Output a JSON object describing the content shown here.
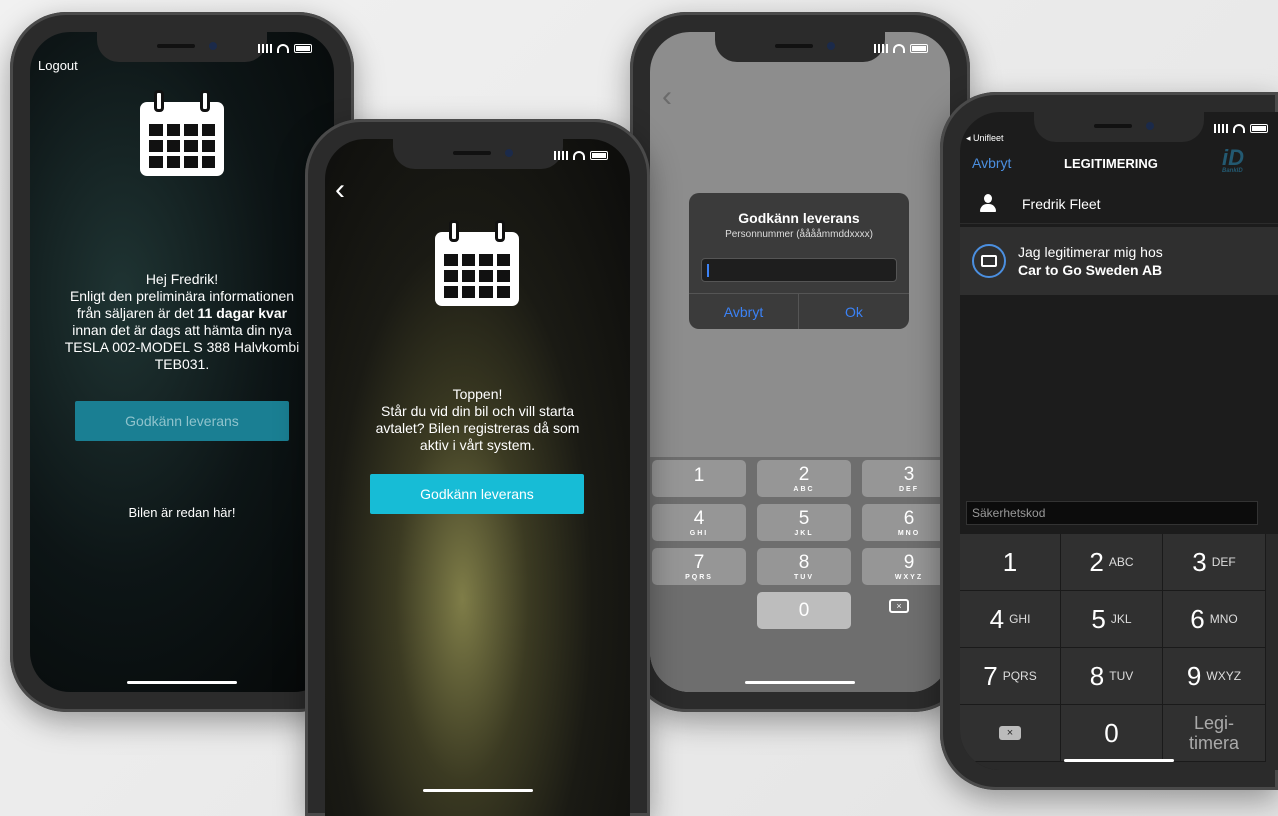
{
  "phone1": {
    "logout": "Logout",
    "message_line1": "Hej Fredrik!",
    "message_line2": "Enligt den preliminära informationen",
    "message_line3": "från säljaren är det",
    "message_bold": "11 dagar kvar",
    "message_line4": "innan det är dags att hämta din nya",
    "message_line5": "TESLA 002-MODEL S 388 Halvkombi",
    "message_line6": "TEB031.",
    "approve_button": "Godkänn leverans",
    "car_here": "Bilen är redan här!"
  },
  "phone2": {
    "back": "‹",
    "title": "Toppen!",
    "line1": "Står du vid din bil och vill starta",
    "line2": "avtalet? Bilen registreras då som",
    "line3": "aktiv i vårt system.",
    "approve_button": "Godkänn leverans"
  },
  "phone3": {
    "back": "‹",
    "dialog_title": "Godkänn leverans",
    "dialog_subtitle": "Personnummer (ååååmmddxxxx)",
    "cancel": "Avbryt",
    "ok": "Ok",
    "keys": [
      {
        "n": "1",
        "l": ""
      },
      {
        "n": "2",
        "l": "ABC"
      },
      {
        "n": "3",
        "l": "DEF"
      },
      {
        "n": "4",
        "l": "GHI"
      },
      {
        "n": "5",
        "l": "JKL"
      },
      {
        "n": "6",
        "l": "MNO"
      },
      {
        "n": "7",
        "l": "PQRS"
      },
      {
        "n": "8",
        "l": "TUV"
      },
      {
        "n": "9",
        "l": "WXYZ"
      },
      {
        "n": "0",
        "l": ""
      }
    ]
  },
  "phone4": {
    "back_app": "◂ Unifleet",
    "cancel": "Avbryt",
    "title": "LEGITIMERING",
    "bankid": "BankID",
    "user_name": "Fredrik Fleet",
    "identify_line1": "Jag legitimerar mig hos",
    "identify_line2": "Car to Go Sweden AB",
    "security_placeholder": "Säkerhetskod",
    "keys": [
      {
        "n": "1",
        "l": ""
      },
      {
        "n": "2",
        "l": "ABC"
      },
      {
        "n": "3",
        "l": "DEF"
      },
      {
        "n": "4",
        "l": "GHI"
      },
      {
        "n": "5",
        "l": "JKL"
      },
      {
        "n": "6",
        "l": "MNO"
      },
      {
        "n": "7",
        "l": "PQRS"
      },
      {
        "n": "8",
        "l": "TUV"
      },
      {
        "n": "9",
        "l": "WXYZ"
      },
      {
        "n": "0",
        "l": ""
      }
    ],
    "legitimera_line1": "Legi-",
    "legitimera_line2": "timera"
  },
  "colors": {
    "teal_button": "#1a7f93",
    "cyan_button": "#17bcd6",
    "ios_blue": "#3b82f6",
    "bankid_blue": "#235971"
  }
}
